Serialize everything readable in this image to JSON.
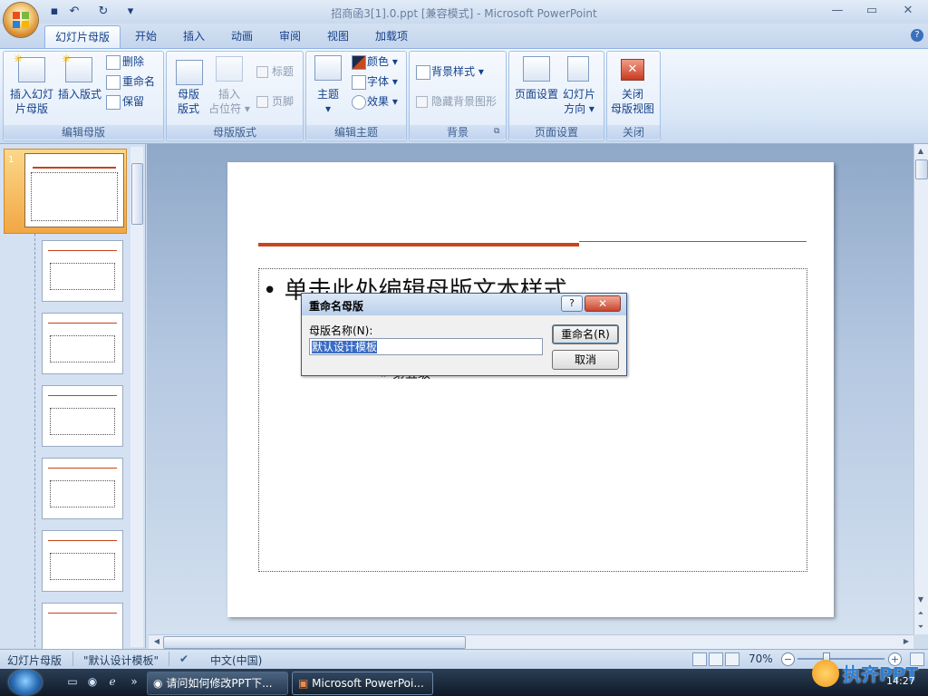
{
  "window": {
    "title": "招商函3[1].0.ppt [兼容模式] - Microsoft PowerPoint",
    "controls": {
      "minimize": "—",
      "maximize": "▭",
      "close": "✕"
    }
  },
  "qat": {
    "save": "▪",
    "undo": "↶",
    "redo": "↻",
    "more": "▾"
  },
  "tabs": [
    {
      "label": "幻灯片母版",
      "active": true
    },
    {
      "label": "开始"
    },
    {
      "label": "插入"
    },
    {
      "label": "动画"
    },
    {
      "label": "审阅"
    },
    {
      "label": "视图"
    },
    {
      "label": "加载项"
    }
  ],
  "help": "?",
  "ribbon": {
    "edit_master": {
      "label": "编辑母版",
      "insert_slide_master": "插入幻灯",
      "insert_slide_master2": "片母版",
      "insert_layout": "插入版式",
      "delete": "删除",
      "rename": "重命名",
      "preserve": "保留"
    },
    "master_layout": {
      "label": "母版版式",
      "master_layout_btn1": "母版",
      "master_layout_btn2": "版式",
      "insert_placeholder1": "插入",
      "insert_placeholder2": "占位符 ▾",
      "title_chk": "标题",
      "footer_chk": "页脚"
    },
    "edit_theme": {
      "label": "编辑主题",
      "themes": "主题",
      "themes_arrow": "▾",
      "colors": "颜色 ▾",
      "fonts": "字体 ▾",
      "effects": "效果 ▾"
    },
    "background": {
      "label": "背景",
      "styles": "背景样式 ▾",
      "hide_bg": "隐藏背景图形",
      "launcher": "⧉"
    },
    "page_setup": {
      "label": "页面设置",
      "page_setup_btn": "页面设置",
      "orientation1": "幻灯片",
      "orientation2": "方向 ▾"
    },
    "close": {
      "label": "关闭",
      "close1": "关闭",
      "close2": "母版视图",
      "close_icon": "✕"
    }
  },
  "thumbnails": {
    "first_num": "1"
  },
  "slide": {
    "bullet1": "• 单击此处编辑母版文本样式",
    "bullet5": "» 第五级"
  },
  "dialog": {
    "title": "重命名母版",
    "help": "?",
    "close": "✕",
    "label": "母版名称(N):",
    "value": "默认设计模板",
    "rename_btn": "重命名(R)",
    "cancel_btn": "取消"
  },
  "status": {
    "view": "幻灯片母版",
    "theme": "\"默认设计模板\"",
    "language": "中文(中国)",
    "zoom": "70%",
    "zoom_minus": "−",
    "zoom_plus": "+"
  },
  "taskbar": {
    "task1": "请问如何修改PPT下...",
    "task2": "Microsoft PowerPoi...",
    "clock": "14:27",
    "watermark": "执齐PPT",
    "more": "»"
  }
}
